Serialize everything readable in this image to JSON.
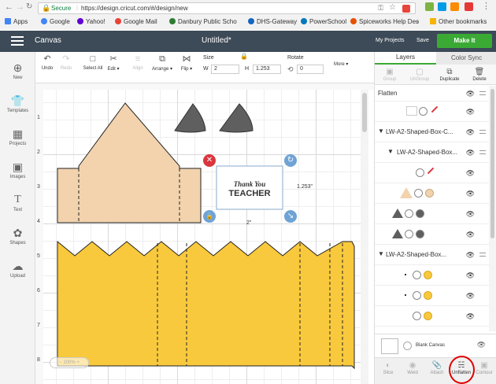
{
  "browser": {
    "secure_label": "Secure",
    "url": "https://design.cricut.com/#/design/new",
    "bookmarks": [
      {
        "label": "Apps",
        "color": "#4285f4"
      },
      {
        "label": "Google",
        "color": "#4285f4"
      },
      {
        "label": "Yahoo!",
        "color": "#6001d2"
      },
      {
        "label": "Google Mail",
        "color": "#ea4335"
      },
      {
        "label": "Danbury Public Scho",
        "color": "#2e7d32"
      },
      {
        "label": "DHS-Gateway",
        "color": "#1565c0"
      },
      {
        "label": "PowerSchool",
        "color": "#0277bd"
      },
      {
        "label": "Spiceworks Help Des",
        "color": "#e65100"
      }
    ],
    "other_bookmarks": "Other bookmarks"
  },
  "app": {
    "name": "Canvas",
    "doc_title": "Untitled*",
    "my_projects": "My Projects",
    "save": "Save",
    "make_it": "Make It",
    "accent": "#3aaa35",
    "header_bg": "#3d4a57"
  },
  "toolbar": {
    "undo": "Undo",
    "redo": "Redo",
    "select_all": "Select All",
    "edit": "Edit",
    "align": "Align",
    "arrange": "Arrange",
    "flip": "Flip",
    "size_label": "Size",
    "w_label": "W",
    "w_value": "2",
    "h_label": "H",
    "h_value": "1.253",
    "rotate_label": "Rotate",
    "rotate_value": "0",
    "more": "More"
  },
  "sidebar": {
    "items": [
      {
        "label": "New",
        "icon": "plus-circle-icon"
      },
      {
        "label": "Templates",
        "icon": "shirt-icon"
      },
      {
        "label": "Projects",
        "icon": "projects-icon"
      },
      {
        "label": "Images",
        "icon": "image-icon"
      },
      {
        "label": "Text",
        "icon": "text-icon"
      },
      {
        "label": "Shapes",
        "icon": "shapes-icon"
      },
      {
        "label": "Upload",
        "icon": "upload-icon"
      }
    ]
  },
  "canvas": {
    "ruler_left": [
      "1",
      "2",
      "3",
      "4",
      "5",
      "6",
      "7",
      "8"
    ],
    "selection_width": "2\"",
    "selection_height": "1.253\"",
    "text_line1": "Thank You",
    "text_line2": "TEACHER",
    "zoom": "100%",
    "colors": {
      "house": "#f2d3ad",
      "box": "#f9c93d",
      "triangle": "#5f5f5f",
      "delete": "#d9363e",
      "handle": "#6fa3d6"
    }
  },
  "panel": {
    "tab_layers": "Layers",
    "tab_color_sync": "Color Sync",
    "actions": [
      "Group",
      "UnGroup",
      "Duplicate",
      "Delete"
    ],
    "flatten_label": "Flatten",
    "groups": [
      "LW-A2-Shaped-Box-C...",
      "LW-A2-Shaped-Box...",
      "LW-A2-Shaped-Box..."
    ],
    "blank_canvas": "Blank Canvas",
    "bottom_actions": [
      "Slice",
      "Weld",
      "Attach",
      "Unflatten",
      "Contour"
    ]
  }
}
